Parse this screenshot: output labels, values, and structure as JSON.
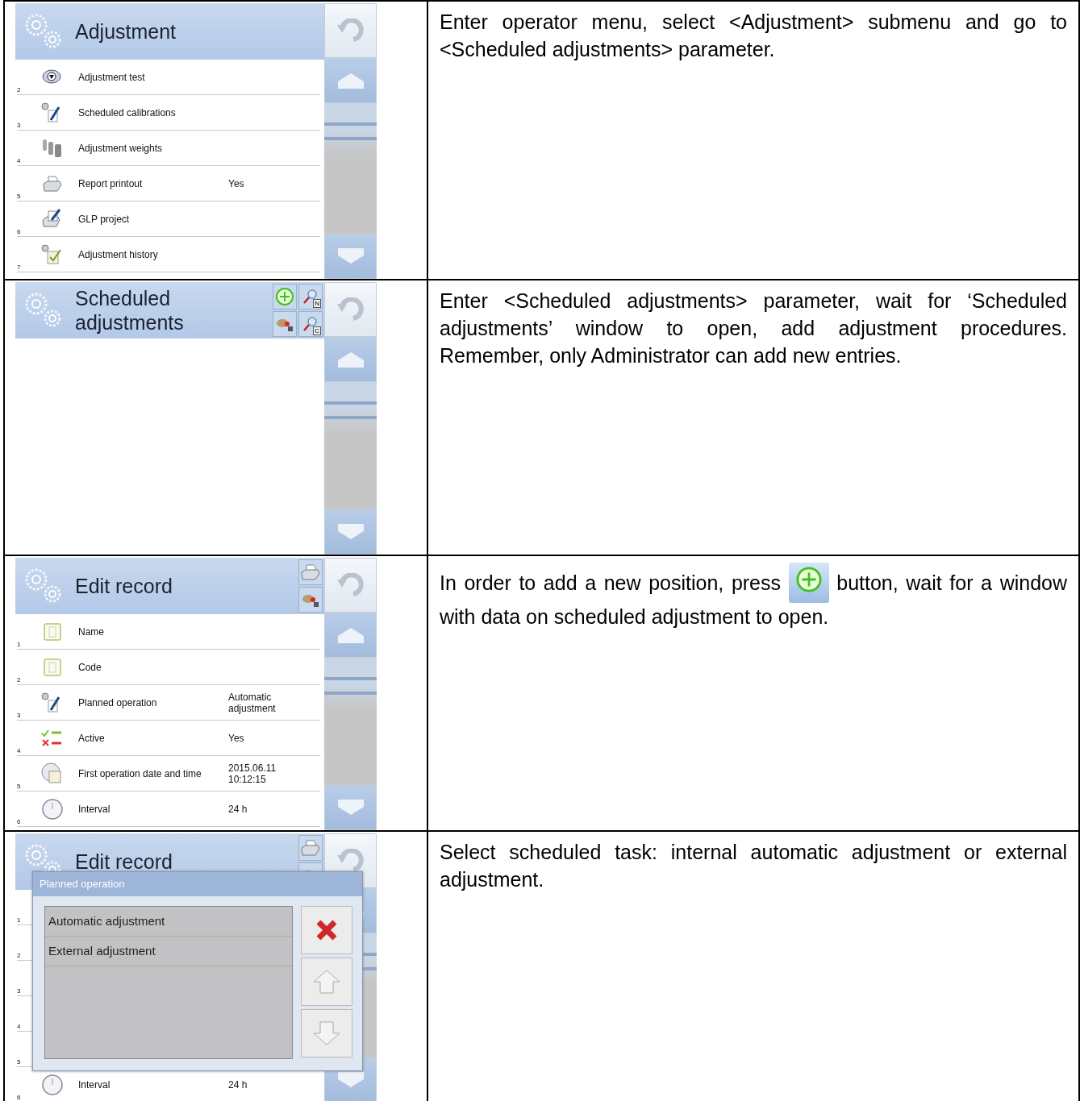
{
  "rows": [
    {
      "screen": {
        "title": "Adjustment",
        "items": [
          {
            "number": "2",
            "label": "Adjustment test",
            "kind": "test"
          },
          {
            "number": "3",
            "label": "Scheduled calibrations",
            "kind": "plan"
          },
          {
            "number": "4",
            "label": "Adjustment weights",
            "kind": "weights"
          },
          {
            "number": "5",
            "label": "Report printout",
            "value": "Yes",
            "kind": "printer"
          },
          {
            "number": "6",
            "label": "GLP project",
            "kind": "glp"
          },
          {
            "number": "7",
            "label": "Adjustment history",
            "kind": "history"
          }
        ]
      },
      "text": "Enter operator menu, select <Adjustment> submenu and go to <Scheduled adjustments> parameter."
    },
    {
      "screen": {
        "title": "Scheduled adjustments",
        "header_buttons": [
          {
            "kind": "add"
          },
          {
            "kind": "search",
            "badge": "N"
          },
          {
            "kind": "export"
          },
          {
            "kind": "search",
            "badge": "C"
          }
        ]
      },
      "text": "Enter <Scheduled adjustments> parameter, wait for ‘Scheduled adjustments’ window to open, add adjustment procedures. Remember, only Administrator can add new entries."
    },
    {
      "screen": {
        "title": "Edit record",
        "header_buttons": [
          {
            "kind": "printer"
          },
          {
            "kind": "export"
          }
        ],
        "items": [
          {
            "number": "1",
            "label": "Name",
            "kind": "name"
          },
          {
            "number": "2",
            "label": "Code",
            "kind": "code"
          },
          {
            "number": "3",
            "label": "Planned operation",
            "value": "Automatic adjustment",
            "kind": "plan"
          },
          {
            "number": "4",
            "label": "Active",
            "value": "Yes",
            "kind": "toggle"
          },
          {
            "number": "5",
            "label": "First operation date and time",
            "value": "2015.06.11 10:12:15",
            "kind": "calendar"
          },
          {
            "number": "6",
            "label": "Interval",
            "value": "24 h",
            "kind": "clock"
          }
        ]
      },
      "text": "In order to add a new position, press",
      "inline_button": {
        "kind": "add"
      },
      "text_after": "button, wait for a window with data on scheduled adjustment to open."
    },
    {
      "screen": {
        "title": "Edit record",
        "header_buttons": [
          {
            "kind": "printer"
          },
          {
            "kind": "export"
          }
        ],
        "items": [
          {
            "number": "1"
          },
          {
            "number": "2"
          },
          {
            "number": "3"
          },
          {
            "number": "4"
          },
          {
            "number": "5"
          },
          {
            "number": "6",
            "label": "Interval",
            "value": "24 h",
            "kind": "clock"
          }
        ],
        "dialog": {
          "title": "Planned operation",
          "options": [
            "Automatic adjustment",
            "External adjustment"
          ]
        }
      },
      "text": "Select scheduled task: internal automatic adjustment or external adjustment."
    }
  ]
}
